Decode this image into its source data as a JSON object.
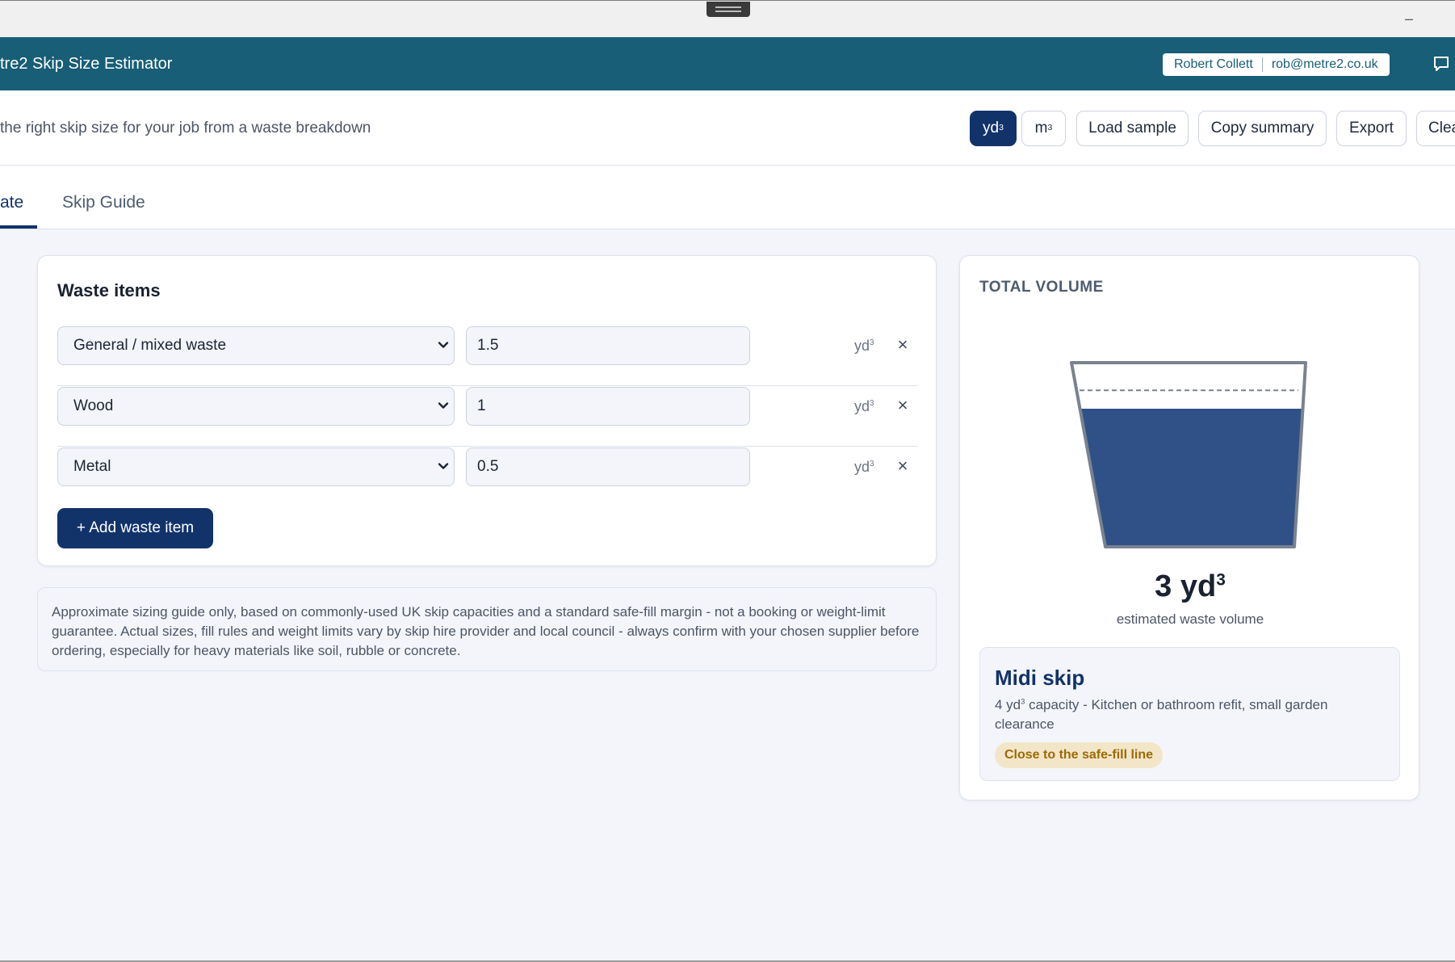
{
  "app": {
    "title": "tre2 Skip Size Estimator",
    "user_name": "Robert Collett",
    "user_email": "rob@metre2.co.uk"
  },
  "icons": {
    "minimize": "minimize-icon",
    "chat": "chat-icon",
    "select": "chevron-down-icon",
    "remove": "close-icon"
  },
  "toolbar": {
    "subtitle": "the right skip size for your job from a waste breakdown",
    "unit_yd_base": "yd",
    "unit_m_base": "m",
    "unit_exp": "3",
    "selected_unit": "yd³",
    "load_sample": "Load sample",
    "copy_summary": "Copy summary",
    "export": "Export",
    "clear": "Clea"
  },
  "tabs": [
    {
      "label": "ate",
      "active": true
    },
    {
      "label": "Skip Guide",
      "active": false
    }
  ],
  "waste": {
    "heading": "Waste items",
    "items": [
      {
        "type": "General / mixed waste",
        "quantity": "1.5",
        "unit": "yd"
      },
      {
        "type": "Wood",
        "quantity": "1",
        "unit": "yd"
      },
      {
        "type": "Metal",
        "quantity": "0.5",
        "unit": "yd"
      }
    ],
    "unit_exp": "3",
    "remove_symbol": "×",
    "add_label": "+ Add waste item"
  },
  "notice": "Approximate sizing guide only, based on commonly-used UK skip capacities and a standard safe-fill margin - not a booking or weight-limit guarantee. Actual sizes, fill rules and weight limits vary by skip hire provider and local council - always confirm with your chosen supplier before ordering, especially for heavy materials like soil, rubble or concrete.",
  "total": {
    "heading": "TOTAL VOLUME",
    "value": "3 yd",
    "value_exp": "3",
    "subtitle": "estimated waste volume",
    "fill_fraction": 0.75,
    "safe_fill_fraction": 0.85,
    "fill_color": "#2f5187",
    "recommendation": {
      "name": "Midi skip",
      "capacity": "4 yd",
      "capacity_exp": "3",
      "description": " capacity - Kitchen or bathroom refit, small garden clearance",
      "badge": "Close to the safe-fill line"
    }
  },
  "colors": {
    "header": "#175e76",
    "primary": "#12336a",
    "badge_bg": "#f3e6c8",
    "badge_text": "#9a6a06"
  }
}
